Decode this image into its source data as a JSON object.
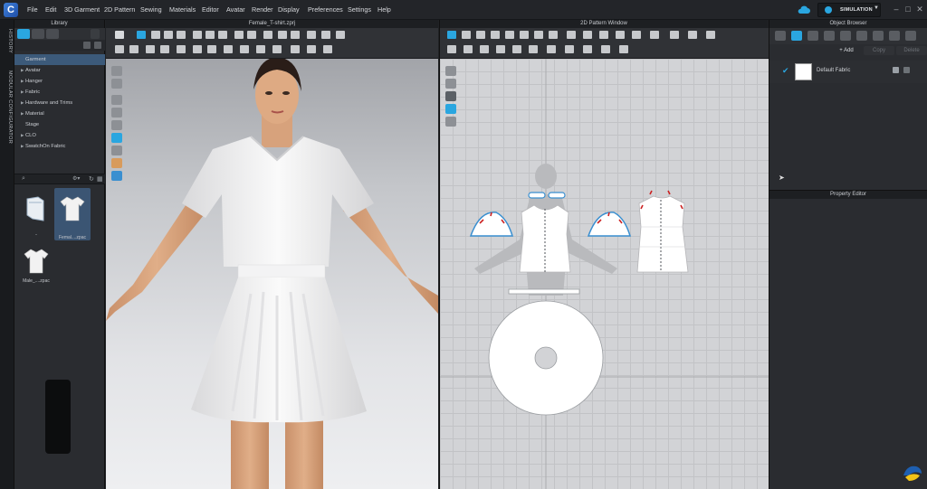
{
  "menubar": {
    "items": [
      "File",
      "Edit",
      "3D Garment",
      "2D Pattern",
      "Sewing",
      "Materials",
      "Editor",
      "Avatar",
      "Render",
      "Display",
      "Preferences",
      "Settings",
      "Help"
    ],
    "simulation_label": "SIMULATION"
  },
  "vertical_tabs": [
    "HISTORY",
    "MODULAR CONFIGURATOR"
  ],
  "library": {
    "title": "Library",
    "tree": [
      {
        "label": "Garment",
        "selected": true,
        "has_arrow": false
      },
      {
        "label": "Avatar",
        "has_arrow": true
      },
      {
        "label": "Hanger",
        "has_arrow": true
      },
      {
        "label": "Fabric",
        "has_arrow": true
      },
      {
        "label": "Hardware and Trims",
        "has_arrow": true
      },
      {
        "label": "Material",
        "has_arrow": true
      },
      {
        "label": "Stage",
        "has_arrow": false
      },
      {
        "label": "CLO",
        "has_arrow": true
      },
      {
        "label": "SwatchOn Fabric",
        "has_arrow": true
      }
    ],
    "thumbnails": [
      {
        "label": "..",
        "icon": "folder-icon"
      },
      {
        "label": "Femal....zpac",
        "icon": "tshirt-icon",
        "selected": true
      },
      {
        "label": "Male_....zpac",
        "icon": "tshirt-icon"
      }
    ]
  },
  "view3d": {
    "title": "Female_T-shirt.zprj"
  },
  "view2d": {
    "title": "2D Pattern Window"
  },
  "object_browser": {
    "title": "Object Browser",
    "add_label": "+ Add",
    "copy_label": "Copy",
    "delete_label": "Delete",
    "fabric_name": "Default Fabric"
  },
  "property_editor": {
    "title": "Property Editor"
  },
  "colors": {
    "accent": "#2aa6e0",
    "selection": "#3c5a7a",
    "panel": "#2a2c30",
    "stitch_red": "#cc2222"
  }
}
